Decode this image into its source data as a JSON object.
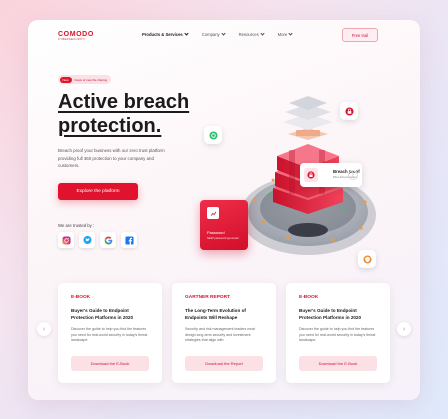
{
  "header": {
    "logo_main": "COMODO",
    "logo_sub": "CYBERSECURITY",
    "nav": [
      {
        "label": "Products & Services"
      },
      {
        "label": "Company"
      },
      {
        "label": "Resources"
      },
      {
        "label": "More"
      }
    ],
    "free_trial": "Free trail"
  },
  "hero": {
    "badge_tag": "New",
    "badge_text": "News of new file sharing",
    "title_line1": "Active breach",
    "title_line2": "protection.",
    "description": "Breach proof your business with our zero trust platform providing full 360 protection to your company and customers.",
    "cta": "Explore the platform",
    "trusted_by": "We are trusted by :"
  },
  "social_icons": [
    "instagram-icon",
    "twitter-icon",
    "google-icon",
    "facebook-icon"
  ],
  "illustration": {
    "breach_title": "Breach proof",
    "breach_sub": "Plus full protection",
    "password_title": "Password",
    "password_sub": "NEW password generator"
  },
  "cards": [
    {
      "tag": "E-BOOK",
      "title": "Buyer's Guide to Endpoint Protection Platforms in 2020",
      "desc": "Discover the guide to help you find the features you need for real-world security in today's threat landscape.",
      "button": "Download the E-Book"
    },
    {
      "tag": "GARTNER REPORT",
      "title": "The Long-Term Evolution of Endpoints Will Reshape",
      "desc": "Security and risk management leaders must design long-term security and investment strategies that align with",
      "button": "Download the Report"
    },
    {
      "tag": "E-BOOK",
      "title": "Buyer's Guide to Endpoint Protection Platforms in 2020",
      "desc": "Discover the guide to help you find the features you need for real-world security in today's threat landscape.",
      "button": "Download the E-Book"
    }
  ],
  "colors": {
    "brand_red": "#e0122d",
    "badge_bg": "#fbe0e5"
  }
}
